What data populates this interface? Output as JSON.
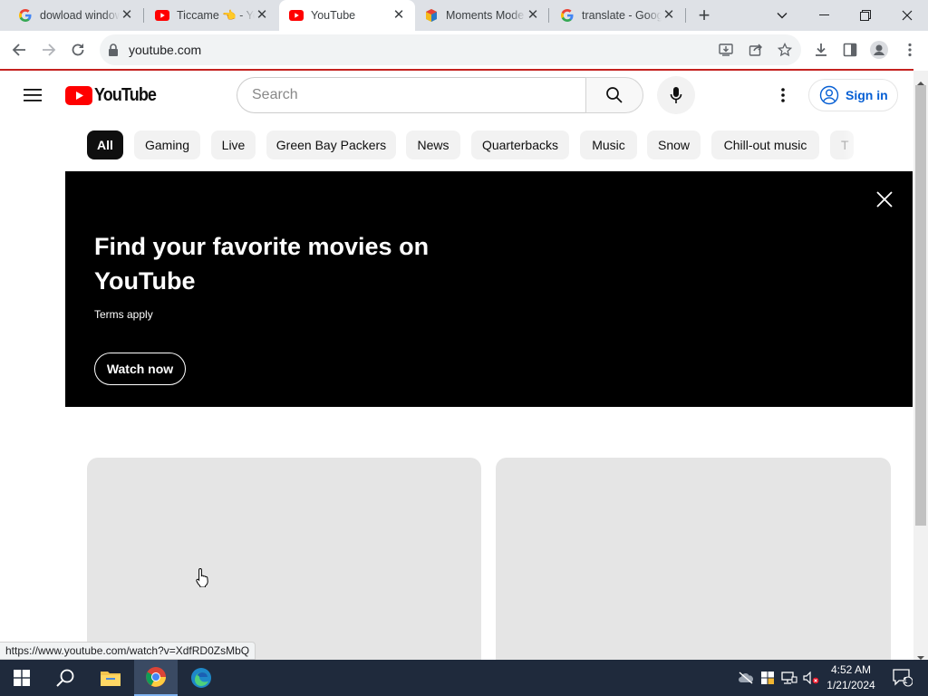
{
  "browser": {
    "tabs": [
      {
        "title": "dowload windows",
        "favicon": "google-g-icon"
      },
      {
        "title": "Ticcame 👈 - YouTube",
        "favicon": "youtube-icon"
      },
      {
        "title": "YouTube",
        "favicon": "youtube-icon",
        "active": true
      },
      {
        "title": "Moments Mode",
        "favicon": "bluestacks-icon"
      },
      {
        "title": "translate - Google",
        "favicon": "google-g-icon"
      }
    ],
    "address": "youtube.com",
    "status_url": "https://www.youtube.com/watch?v=XdfRD0ZsMbQ"
  },
  "youtube": {
    "logo_text": "YouTube",
    "search_placeholder": "Search",
    "sign_in_label": "Sign in",
    "chips": [
      "All",
      "Gaming",
      "Live",
      "Green Bay Packers",
      "News",
      "Quarterbacks",
      "Music",
      "Snow",
      "Chill-out music",
      "T"
    ],
    "banner": {
      "title": "Find your favorite movies on YouTube",
      "terms": "Terms apply",
      "button": "Watch now"
    }
  },
  "taskbar": {
    "time": "4:52 AM",
    "date": "1/21/2024",
    "notification_count": "1"
  },
  "colors": {
    "youtube_red": "#ff0000",
    "link_blue": "#065fd4",
    "taskbar": "#1f2a3c",
    "accent_line": "#c5221f"
  }
}
